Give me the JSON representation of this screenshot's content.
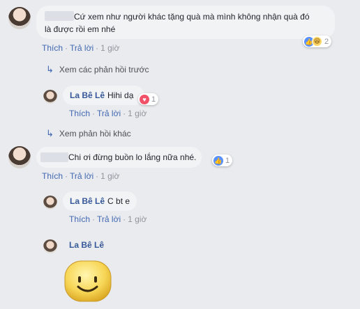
{
  "comments": [
    {
      "text_line1": "Cứ xem như người khác tặng quà mà mình không nhận quà đó",
      "text_line2": "là được rồi em nhé",
      "actions": {
        "like": "Thích",
        "reply": "Trả lời",
        "time": "1 giờ"
      },
      "reactions": {
        "icons": [
          "like-icon",
          "haha-icon"
        ],
        "count": "2"
      },
      "view_previous": "Xem các phản hồi trước",
      "replies": [
        {
          "author": "La Bê Lê",
          "text": "Hihi dạ",
          "actions": {
            "like": "Thích",
            "reply": "Trả lời",
            "time": "1 giờ"
          },
          "reactions": {
            "icons": [
              "love-icon"
            ],
            "count": "1"
          }
        }
      ],
      "view_more": "Xem phản hồi khác"
    },
    {
      "text": "Chi ơi đừng buồn lo lắng nữa nhé.",
      "actions": {
        "like": "Thích",
        "reply": "Trả lời",
        "time": "1 giờ"
      },
      "reactions": {
        "icons": [
          "like-icon"
        ],
        "count": "1"
      },
      "replies": [
        {
          "author": "La Bê Lê",
          "text": "C bt e",
          "actions": {
            "like": "Thích",
            "reply": "Trả lời",
            "time": "1 giờ"
          }
        }
      ]
    }
  ],
  "draft_reply": {
    "author": "La Bê Lê",
    "sticker": "smiley-face-sticker"
  },
  "colors": {
    "background": "#e9ebee",
    "bubble": "#f2f3f5",
    "link": "#4267b2",
    "author": "#365899",
    "meta": "#90949c",
    "like": "#5890ff",
    "love": "#f25268",
    "haha": "#fcd667"
  }
}
